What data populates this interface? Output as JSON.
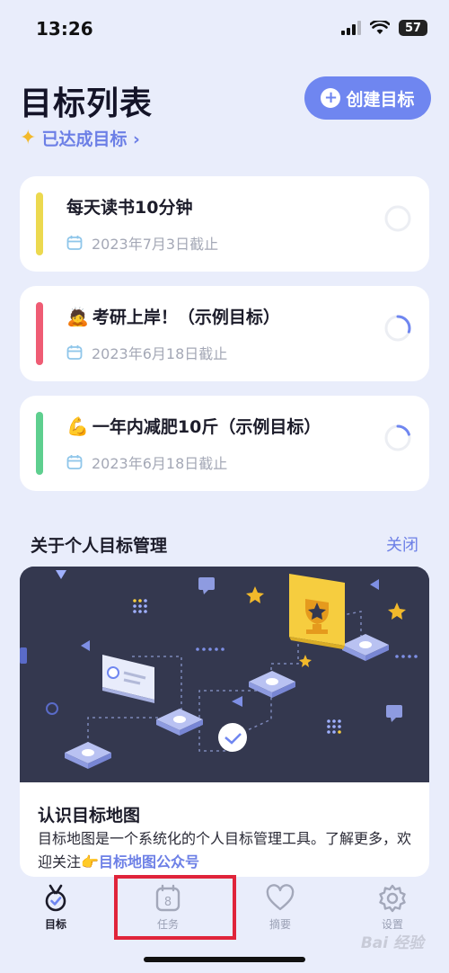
{
  "status_bar": {
    "time": "13:26",
    "battery": "57"
  },
  "header": {
    "title": "目标列表",
    "create_label": "创建目标",
    "achieved_label": "已达成目标 ›"
  },
  "goals": [
    {
      "emoji": "",
      "title": "每天读书10分钟",
      "deadline": "2023年7月3日截止",
      "bar_color": "#ecd94f",
      "progress": 0.0
    },
    {
      "emoji": "🙇",
      "title": "考研上岸！（示例目标）",
      "deadline": "2023年6月18日截止",
      "bar_color": "#ef5c74",
      "progress": 0.3
    },
    {
      "emoji": "💪",
      "title": "一年内减肥10斤（示例目标）",
      "deadline": "2023年6月18日截止",
      "bar_color": "#5ecf8f",
      "progress": 0.2
    }
  ],
  "section": {
    "title": "关于个人目标管理",
    "close_label": "关闭"
  },
  "info_card": {
    "title": "认识目标地图",
    "body_text": "目标地图是一个系统化的个人目标管理工具。了解更多，欢迎关注👉",
    "body_link": "目标地图公众号"
  },
  "tabs": [
    {
      "label": "目标",
      "icon": "medal-check-icon",
      "active": true
    },
    {
      "label": "任务",
      "icon": "calendar-8-icon",
      "active": false
    },
    {
      "label": "摘要",
      "icon": "heart-icon",
      "active": false
    },
    {
      "label": "设置",
      "icon": "gear-icon",
      "active": false
    }
  ],
  "watermark": "Bai 经验",
  "colors": {
    "accent": "#6f86f0",
    "background": "#e9edfb",
    "highlight": "#e0243a"
  }
}
